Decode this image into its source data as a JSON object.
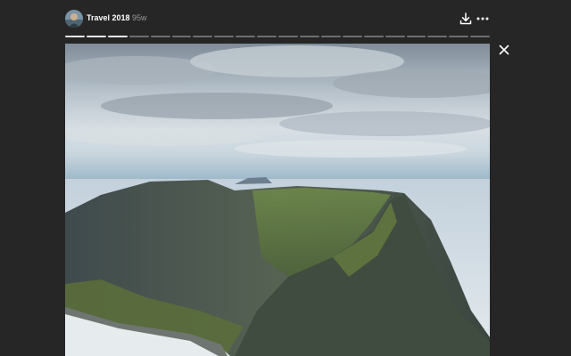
{
  "story": {
    "title": "Travel 2018",
    "age": "95w",
    "segments": {
      "total": 20,
      "completed": 3
    }
  },
  "icons": {
    "avatar": "avatar-photo",
    "download": "download-icon",
    "more": "more-icon",
    "close": "close-icon"
  },
  "colors": {
    "background": "#262626",
    "text": "#ffffff",
    "muted": "#9a9a9a",
    "progress_done": "#e6e6e6",
    "progress_pending": "#6e6e6e"
  }
}
